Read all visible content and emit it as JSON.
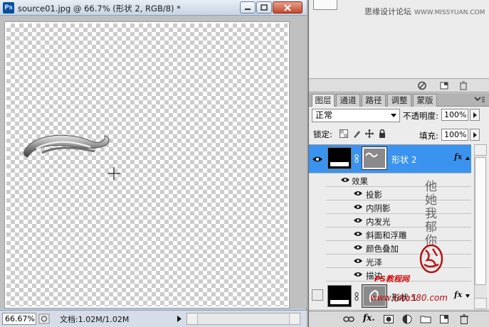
{
  "document": {
    "title": "source01.jpg @ 66.7% (形状 2, RGB/8) *",
    "app_icon": "Ps",
    "zoom": "66.67%",
    "doc_size": "文档:1.02M/1.02M"
  },
  "watermark": {
    "site_name": "思缘设计论坛",
    "site_url": "WWW.MISSYUAN.COM",
    "vertical_text": "他她我郁你",
    "ps_text": "PS教程网",
    "url_text": "www.tata580.com"
  },
  "panel_tabs": [
    "图层",
    "通道",
    "路径",
    "调整",
    "蒙版"
  ],
  "layers_panel": {
    "blend_mode": "正常",
    "opacity_label": "不透明度:",
    "opacity_value": "100%",
    "lock_label": "锁定:",
    "fill_label": "填充:",
    "fill_value": "100%",
    "layers": [
      {
        "name": "形状 2",
        "selected": true,
        "fx": "fx",
        "effects_group_label": "效果",
        "effects": [
          "投影",
          "内阴影",
          "内发光",
          "斜面和浮雕",
          "颜色叠加",
          "光泽",
          "描边"
        ]
      },
      {
        "name": "形状 1",
        "selected": false,
        "fx": "fx"
      }
    ]
  },
  "icons": {
    "minimize": "minimize-icon",
    "maximize": "maximize-icon",
    "close": "close-icon",
    "eye": "eye-icon",
    "link": "link-icon",
    "fx": "fx-icon",
    "mask": "add-mask-icon",
    "adjustment": "adjustment-layer-icon",
    "group": "folder-icon",
    "new_layer": "new-layer-icon",
    "delete": "trash-icon"
  }
}
